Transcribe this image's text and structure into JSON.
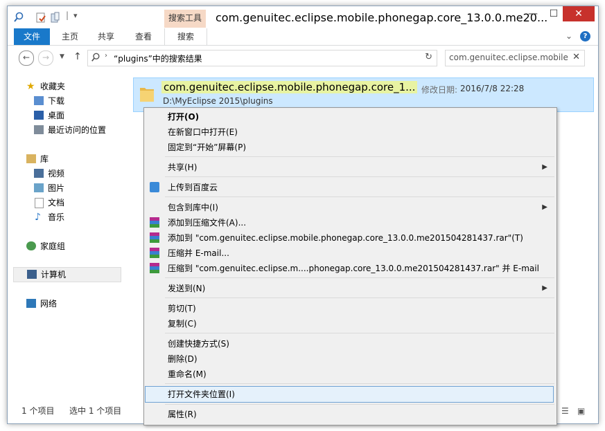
{
  "window": {
    "title": "com.genuitec.eclipse.mobile.phonegap.core_13.0.0.me20...",
    "contextual_tab_group": "搜索工具",
    "controls": {
      "minimize": "—",
      "maximize": "☐",
      "close": "✕"
    }
  },
  "ribbon": {
    "tabs": [
      {
        "label": "文件"
      },
      {
        "label": "主页"
      },
      {
        "label": "共享"
      },
      {
        "label": "查看"
      },
      {
        "label": "搜索"
      }
    ],
    "collapse_icon": "chevron-down-icon",
    "help_icon": "help-icon"
  },
  "address": {
    "path": "“plugins”中的搜索结果",
    "search_value": "com.genuitec.eclipse.mobile.p"
  },
  "nav": {
    "favorites": {
      "label": "收藏夹",
      "items": [
        "下载",
        "桌面",
        "最近访问的位置"
      ]
    },
    "library": {
      "label": "库",
      "items": [
        "视频",
        "图片",
        "文档",
        "音乐"
      ]
    },
    "homegroup": "家庭组",
    "computer": "计算机",
    "network": "网络"
  },
  "file": {
    "name": "com.genuitec.eclipse.mobile.phonegap.core_1...",
    "modified_label": "修改日期:",
    "modified_value": "2016/7/8 22:28",
    "path": "D:\\MyEclipse 2015\\plugins"
  },
  "status": {
    "count": "1 个项目",
    "selected": "选中 1 个项目"
  },
  "context_menu": {
    "items": [
      {
        "label": "打开(O)"
      },
      {
        "label": "在新窗口中打开(E)"
      },
      {
        "label": "固定到“开始”屏幕(P)"
      },
      {
        "label": "共享(H)"
      },
      {
        "label": "上传到百度云"
      },
      {
        "label": "包含到库中(I)"
      },
      {
        "label": "添加到压缩文件(A)..."
      },
      {
        "label": "添加到 \"com.genuitec.eclipse.mobile.phonegap.core_13.0.0.me201504281437.rar\"(T)"
      },
      {
        "label": "压缩并 E-mail..."
      },
      {
        "label": "压缩到 \"com.genuitec.eclipse.m....phonegap.core_13.0.0.me201504281437.rar\" 并 E-mail"
      },
      {
        "label": "发送到(N)"
      },
      {
        "label": "剪切(T)"
      },
      {
        "label": "复制(C)"
      },
      {
        "label": "创建快捷方式(S)"
      },
      {
        "label": "删除(D)"
      },
      {
        "label": "重命名(M)"
      },
      {
        "label": "打开文件夹位置(I)"
      },
      {
        "label": "属性(R)"
      }
    ]
  },
  "colors": {
    "file_tab": "#1979ca",
    "selection": "#cce8ff",
    "close_button": "#c7312c",
    "contextual_tab": "#f6d9c6"
  }
}
